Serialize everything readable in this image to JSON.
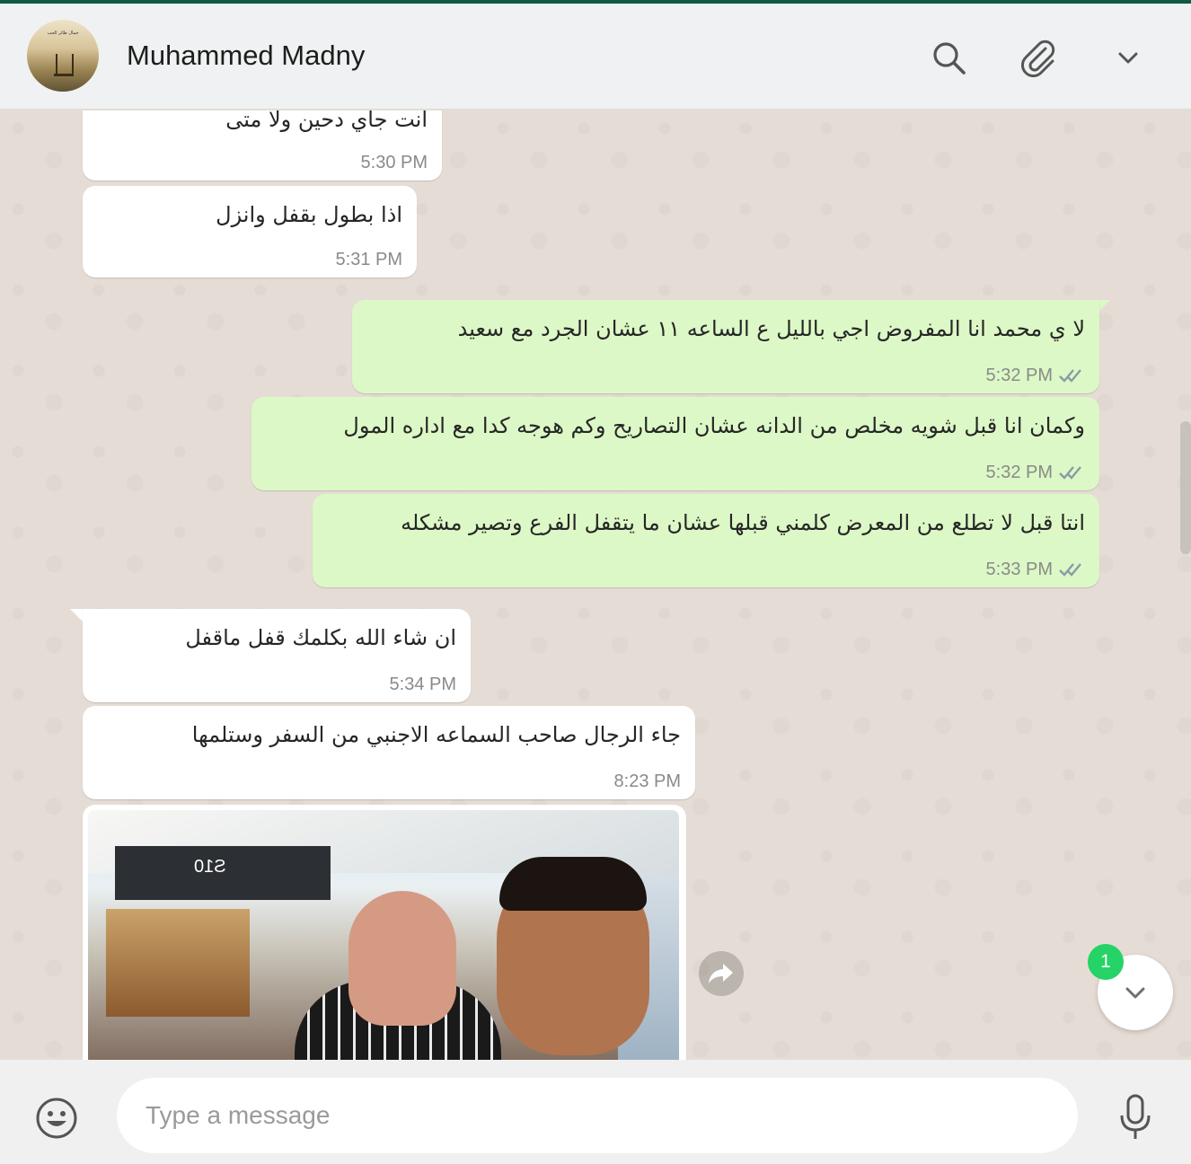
{
  "header": {
    "contact_name": "Muhammed Madny",
    "avatar_caption": "جمال طائر الحب",
    "icons": [
      "search-icon",
      "attach-icon",
      "chevron-down-icon"
    ]
  },
  "messages": [
    {
      "dir": "in",
      "text": "انت جاي دحين ولا متى",
      "time": "5:30 PM"
    },
    {
      "dir": "in",
      "text": "اذا بطول بقفل وانزل",
      "time": "5:31 PM"
    },
    {
      "dir": "out",
      "text": "لا ي محمد انا المفروض اجي بالليل ع الساعه ١١ عشان الجرد مع سعيد",
      "time": "5:32 PM",
      "status": "read"
    },
    {
      "dir": "out",
      "text": "وكمان انا قبل شويه مخلص من الدانه عشان التصاريح وكم هوجه كدا مع اداره المول",
      "time": "5:32 PM",
      "status": "read"
    },
    {
      "dir": "out",
      "text": "انتا قبل لا تطلع من المعرض كلمني قبلها عشان ما يتقفل الفرع وتصير مشكله",
      "time": "5:33 PM",
      "status": "read"
    },
    {
      "dir": "in",
      "text": "ان شاء الله بكلمك قفل ماقفل",
      "time": "5:34 PM"
    },
    {
      "dir": "in",
      "text": "جاء الرجال صاحب السماعه الاجنبي من السفر وستلمها",
      "time": "8:23 PM"
    }
  ],
  "photo": {
    "sign_text": "S10",
    "icons": [
      "forward-icon"
    ]
  },
  "unread_badge": "1",
  "composer": {
    "placeholder": "Type a message",
    "icons": [
      "emoji-icon",
      "mic-icon"
    ]
  },
  "colors": {
    "incoming_bubble": "#ffffff",
    "outgoing_bubble": "#dcf8c6",
    "chat_background": "#e5ddd5",
    "read_ticks": "#8a9ba8",
    "badge": "#25d366"
  }
}
